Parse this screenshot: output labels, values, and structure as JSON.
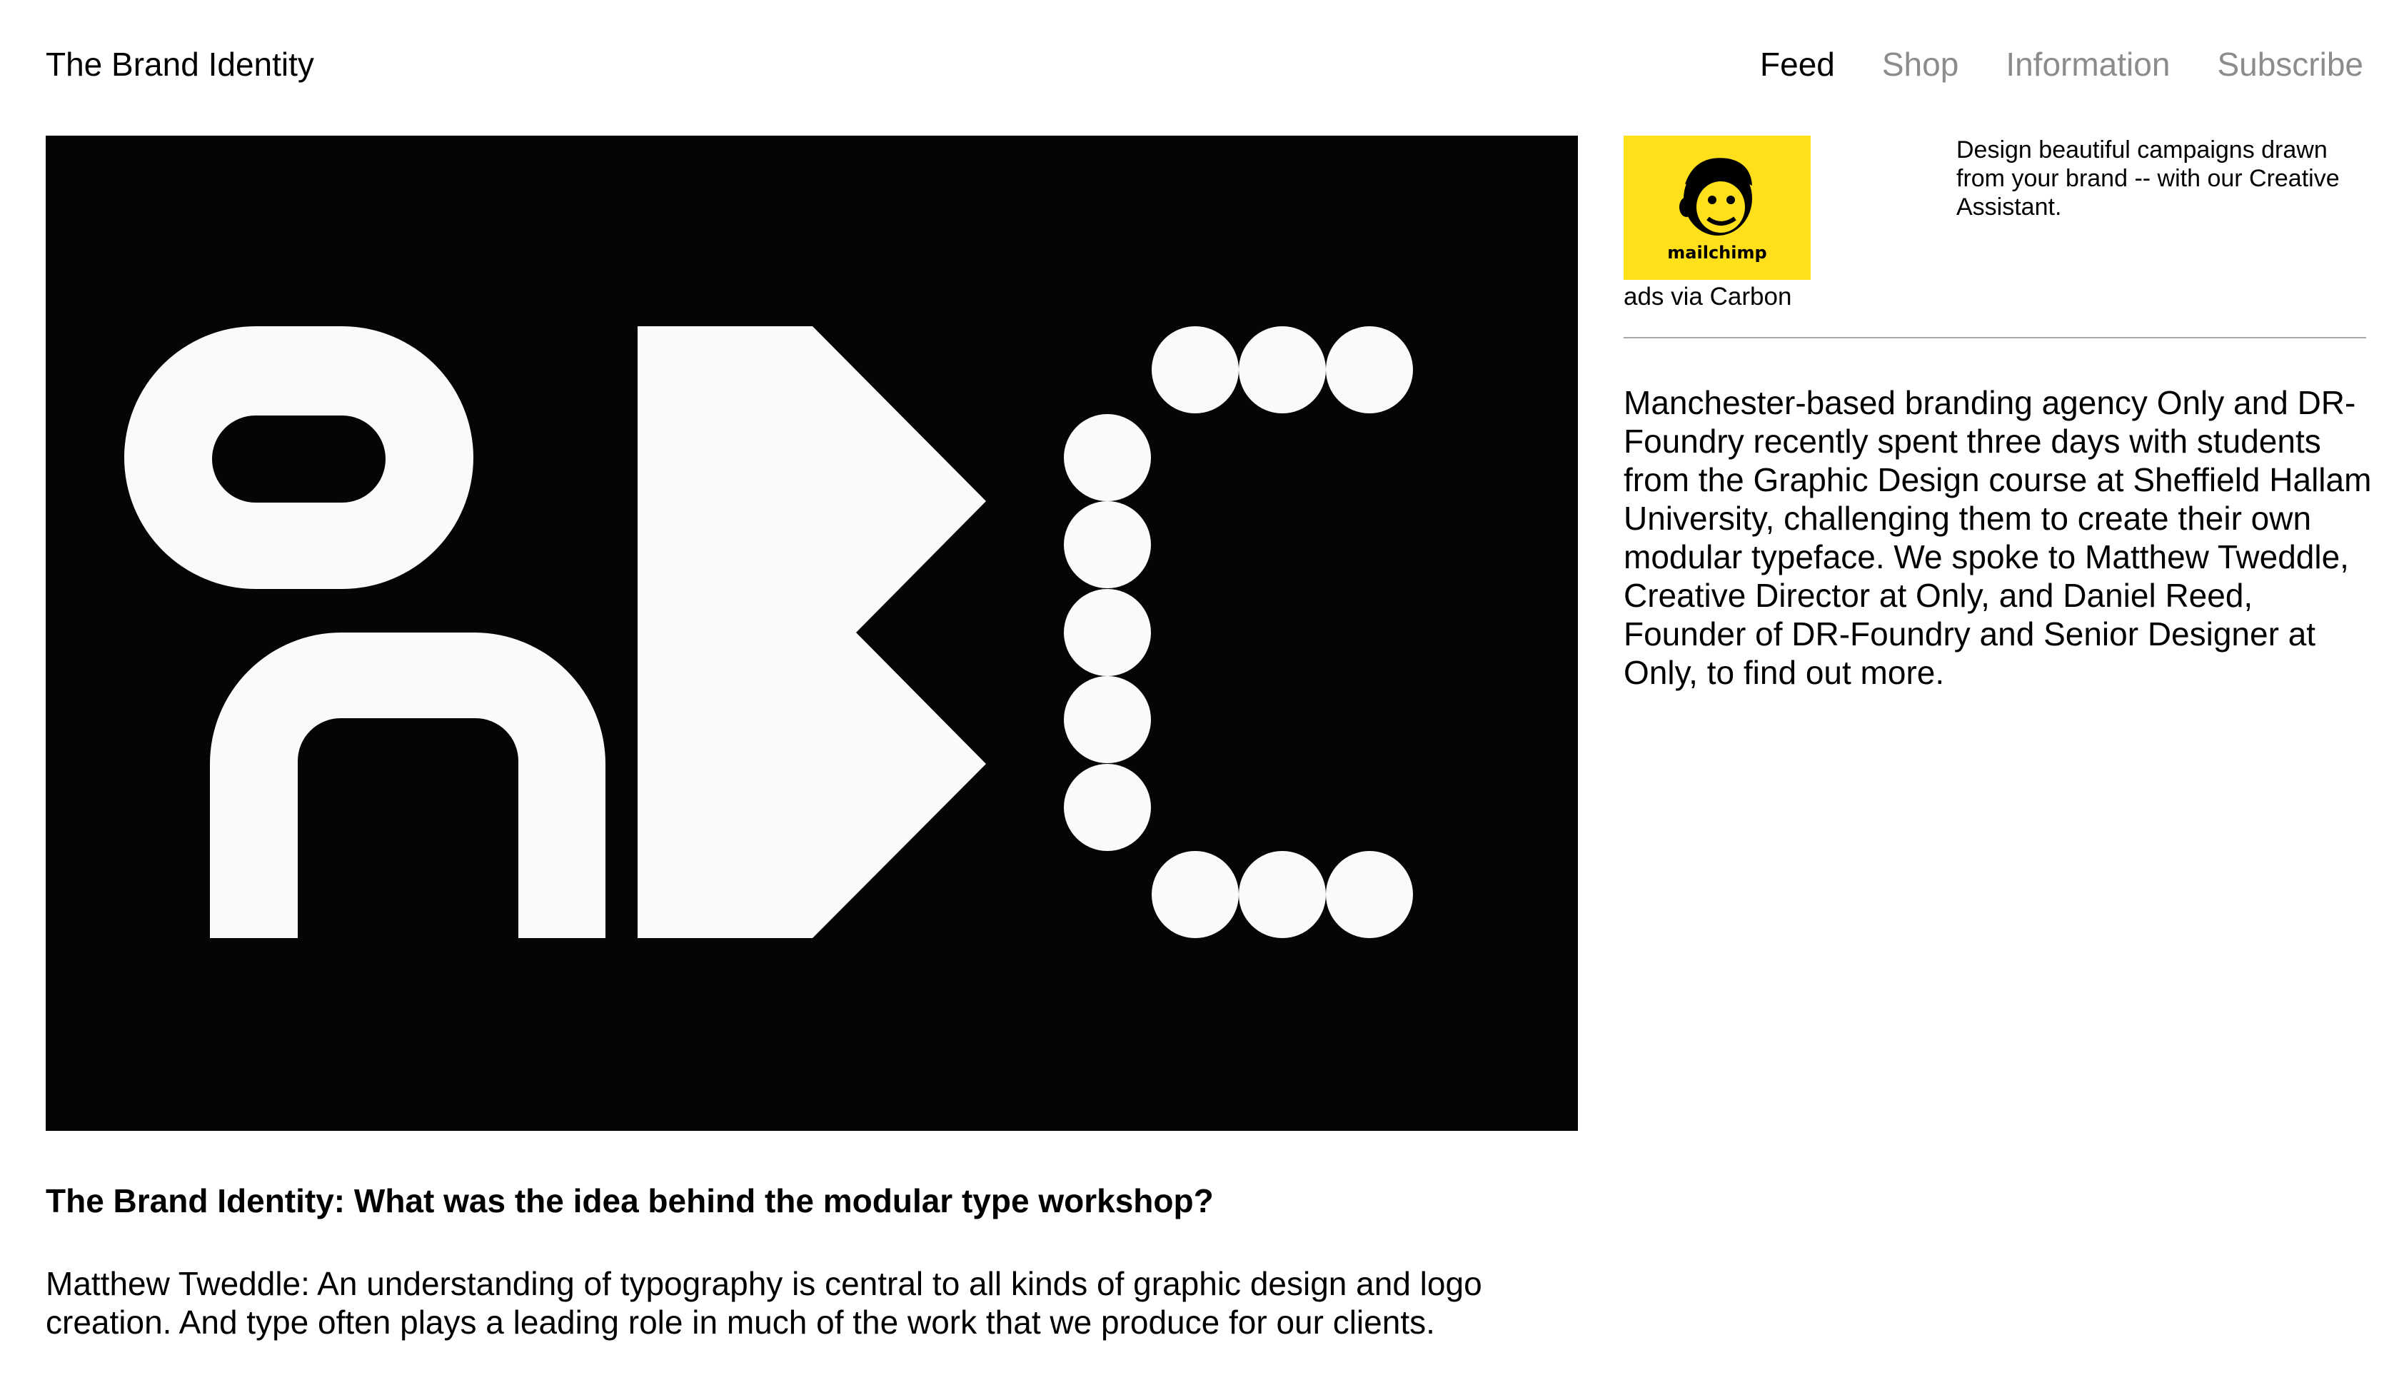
{
  "header": {
    "site_title": "The Brand Identity",
    "nav": [
      {
        "label": "Feed",
        "active": true
      },
      {
        "label": "Shop",
        "active": false
      },
      {
        "label": "Information",
        "active": false
      },
      {
        "label": "Subscribe",
        "active": false
      }
    ]
  },
  "hero": {
    "alt": "Modular typeface letters O, B, C",
    "background": "#050505",
    "glyph_color": "#fafafa"
  },
  "ad": {
    "logo_text": "mailchimp",
    "logo_icon": "mailchimp-freddie-icon",
    "brand_color": "#ffe01b",
    "via": "ads via Carbon",
    "text": "Design beautiful campaigns drawn from your brand -- with our Creative Assistant."
  },
  "article": {
    "intro": "Manchester-based branding agency Only and DR-Foundry recently spent three days with students from the Graphic Design course at Sheffield Hallam University, challenging them to create their own modular typeface. We spoke to Matthew Tweddle, Creative Director at Only, and Daniel Reed, Founder of DR-Foundry and Senior Designer at Only, to find out more.",
    "question": "The Brand Identity: What was the idea behind the modular type workshop?",
    "answer": "Matthew Tweddle: An understanding of typography is central to all kinds of graphic design and logo creation. And type often plays a leading role in much of the work that we produce for our clients."
  }
}
